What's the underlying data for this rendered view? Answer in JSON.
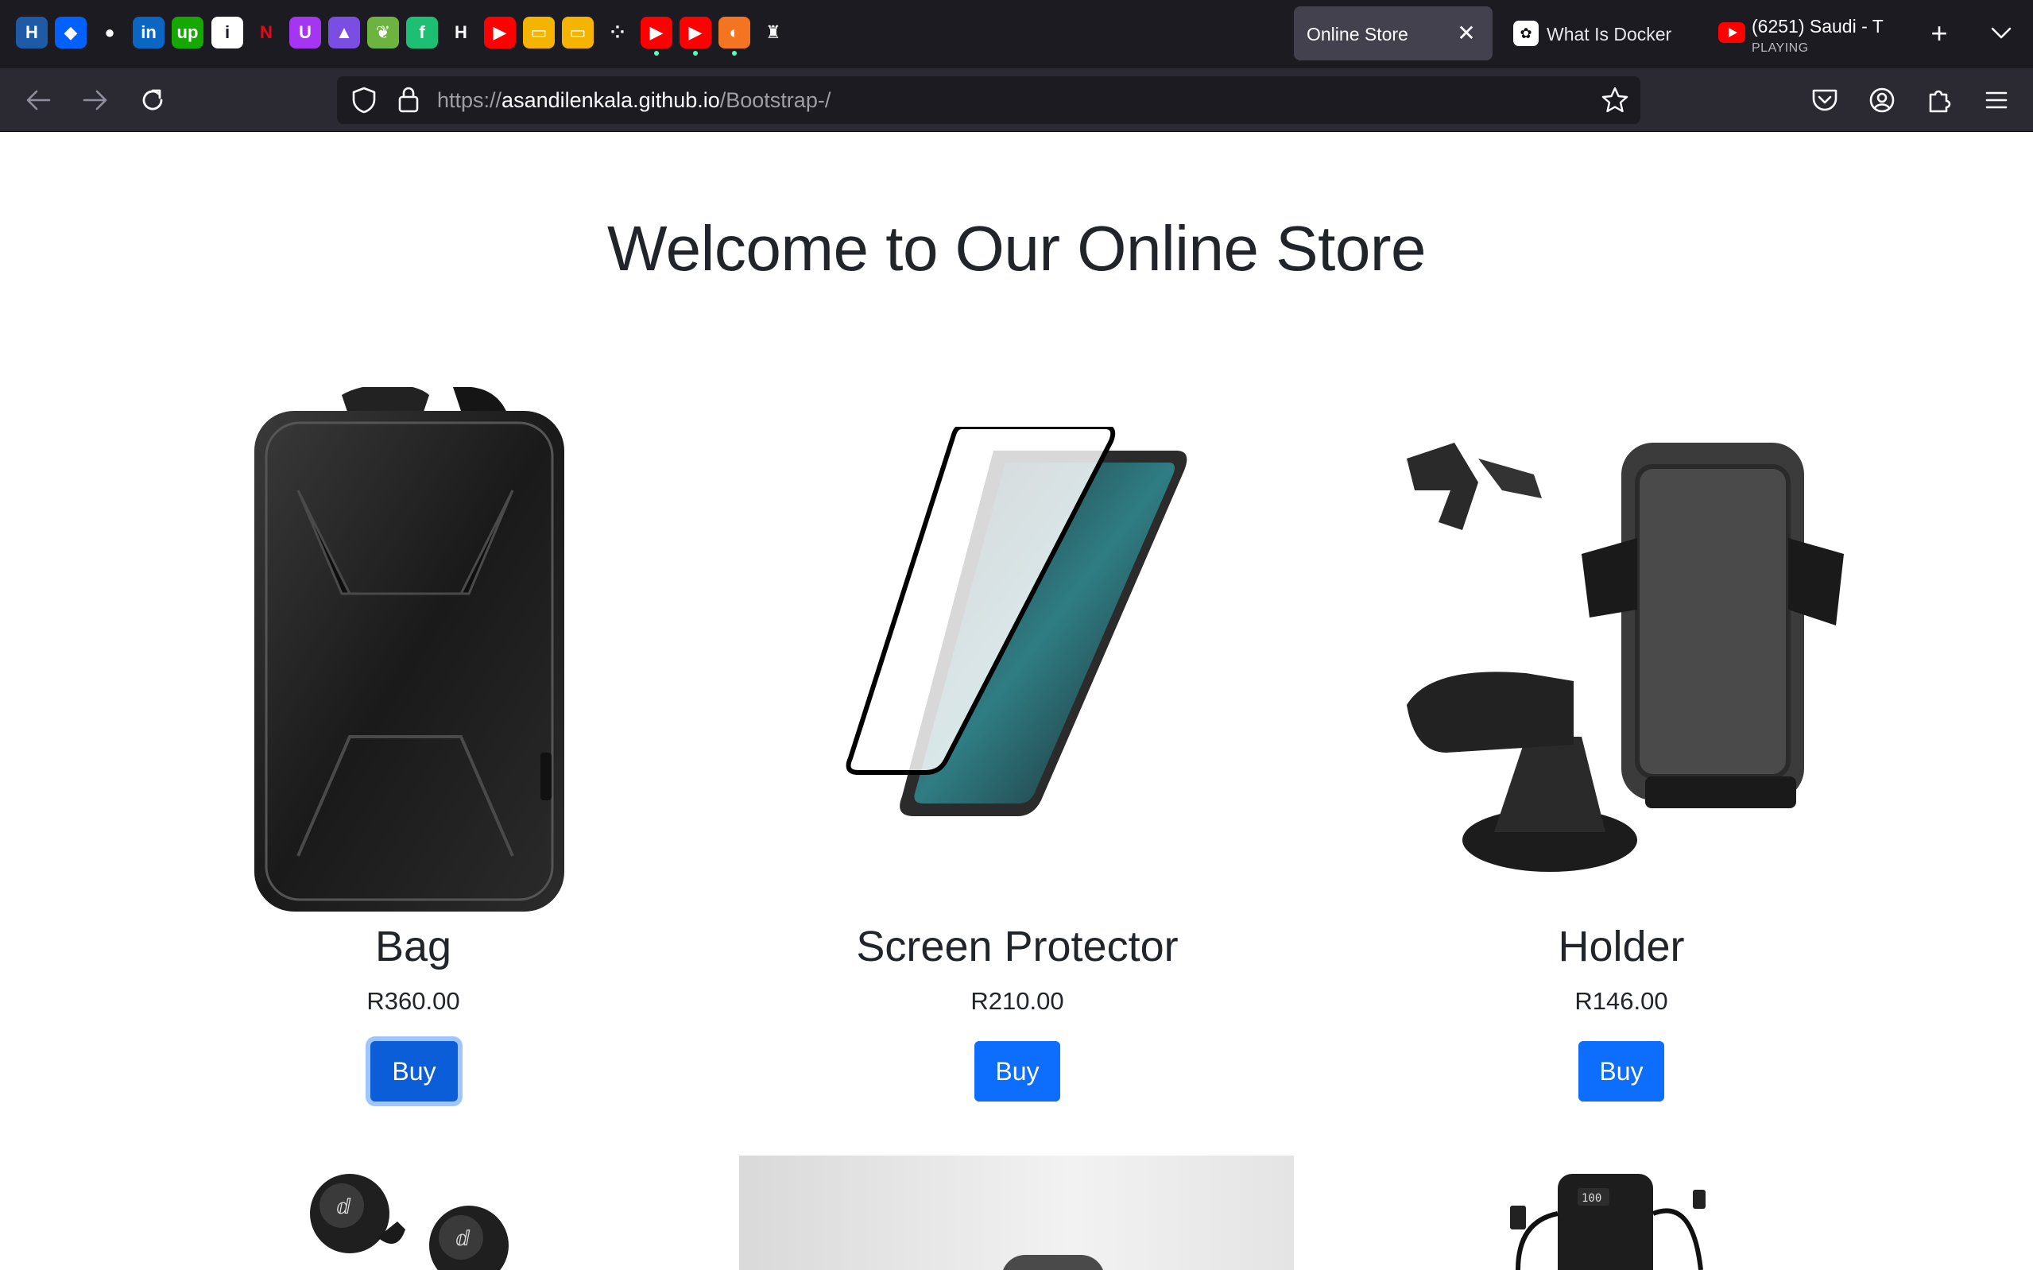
{
  "browser": {
    "pinned_tabs": [
      {
        "icon": "hackerrank-icon",
        "glyph": "H",
        "bg": "#1e5aa5"
      },
      {
        "icon": "dropbox-icon",
        "glyph": "◆",
        "bg": "#0061fe"
      },
      {
        "icon": "github-icon",
        "glyph": "●",
        "bg": "#1c1b22"
      },
      {
        "icon": "linkedin-icon",
        "glyph": "in",
        "bg": "#0a66c2"
      },
      {
        "icon": "upwork-icon",
        "glyph": "up",
        "bg": "#14a800"
      },
      {
        "icon": "info-icon",
        "glyph": "i",
        "bg": "#ffffff"
      },
      {
        "icon": "netflix-icon",
        "glyph": "N",
        "bg": "#1c1b22"
      },
      {
        "icon": "udemy-icon",
        "glyph": "U",
        "bg": "#a435f0"
      },
      {
        "icon": "app-purple-icon",
        "glyph": "▲",
        "bg": "#7a4ee3"
      },
      {
        "icon": "spring-icon",
        "glyph": "❦",
        "bg": "#6db33f"
      },
      {
        "icon": "fiverr-icon",
        "glyph": "f",
        "bg": "#1dbf73"
      },
      {
        "icon": "hyperskill-icon",
        "glyph": "H",
        "bg": "#1c1b22"
      },
      {
        "icon": "youtube-icon",
        "glyph": "▶",
        "bg": "#ff0000"
      },
      {
        "icon": "slides-icon",
        "glyph": "▭",
        "bg": "#f4b400"
      },
      {
        "icon": "slides-icon-2",
        "glyph": "▭",
        "bg": "#f4b400"
      },
      {
        "icon": "dots-app-icon",
        "glyph": "⁘",
        "bg": "#1c1b22"
      },
      {
        "icon": "youtube-playing-icon",
        "glyph": "▶",
        "bg": "#ff0000"
      },
      {
        "icon": "youtube-playing-icon-2",
        "glyph": "▶",
        "bg": "#ff0000"
      },
      {
        "icon": "crunchyroll-icon",
        "glyph": "◐",
        "bg": "#f47521"
      },
      {
        "icon": "crest-icon",
        "glyph": "♜",
        "bg": "#1c1b22"
      }
    ],
    "active_tab": {
      "title": "Online Store"
    },
    "tabs": [
      {
        "title": "What Is Docker",
        "icon": "chatgpt-icon"
      },
      {
        "title": "(6251) Saudi - T",
        "subtitle": "PLAYING",
        "icon": "youtube-icon"
      }
    ],
    "url": {
      "scheme": "https://",
      "host": "asandilenkala.github.io",
      "path": "/Bootstrap-/"
    }
  },
  "page": {
    "heading": "Welcome to Our Online Store",
    "products": [
      {
        "name": "Bag",
        "price": "R360.00",
        "button": "Buy",
        "image": "backpack-image"
      },
      {
        "name": "Screen Protector",
        "price": "R210.00",
        "button": "Buy",
        "image": "screen-protector-image"
      },
      {
        "name": "Holder",
        "price": "R146.00",
        "button": "Buy",
        "image": "phone-holder-image"
      }
    ],
    "next_row_images": [
      "earbuds-image",
      "product-photo-image",
      "power-bank-image"
    ]
  },
  "colors": {
    "primary": "#0d6efd",
    "tabbar": "#1c1b22",
    "navbar": "#2b2a33",
    "text": "#212529"
  }
}
